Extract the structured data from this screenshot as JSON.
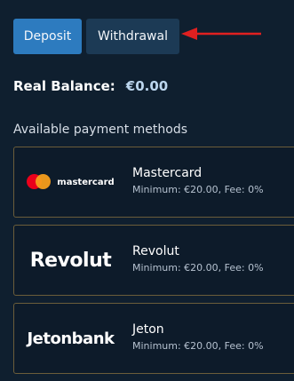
{
  "tabs": {
    "deposit_label": "Deposit",
    "withdrawal_label": "Withdrawal"
  },
  "balance": {
    "label": "Real Balance:",
    "value": "€0.00"
  },
  "payments": {
    "title": "Available payment methods",
    "methods": [
      {
        "logo_text": "mastercard",
        "name": "Mastercard",
        "detail": "Minimum: €20.00, Fee: 0%"
      },
      {
        "logo_text": "Revolut",
        "name": "Revolut",
        "detail": "Minimum: €20.00, Fee: 0%"
      },
      {
        "logo_text": "Jetonbank",
        "name": "Jeton",
        "detail": "Minimum: €20.00, Fee: 0%"
      }
    ]
  },
  "colors": {
    "background": "#0f1f2f",
    "deposit_tab": "#2d7bbf",
    "withdrawal_tab": "#1c3a55",
    "card_border": "#6b5d3a",
    "arrow": "#e02020"
  },
  "icons": {
    "annotation": "red-arrow-icon"
  }
}
